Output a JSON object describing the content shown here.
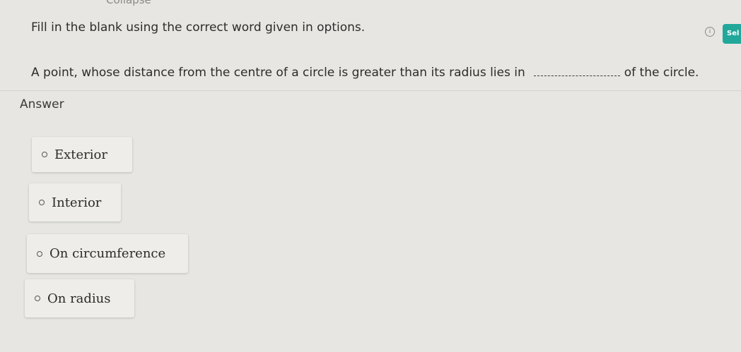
{
  "header": {
    "collapse_label": "Collapse ^",
    "info_icon": "info-icon",
    "select_label": "Sel"
  },
  "question": {
    "instruction": "Fill in the blank using the correct word given in options.",
    "text_before": "A point, whose distance from the centre of a circle is greater than its radius lies in",
    "text_after": "of the circle."
  },
  "answer": {
    "label": "Answer",
    "options": [
      {
        "label": "Exterior"
      },
      {
        "label": "Interior"
      },
      {
        "label": "On circumference"
      },
      {
        "label": "On radius"
      }
    ]
  },
  "colors": {
    "background": "#e7e6e2",
    "select_button": "#21a89a"
  }
}
